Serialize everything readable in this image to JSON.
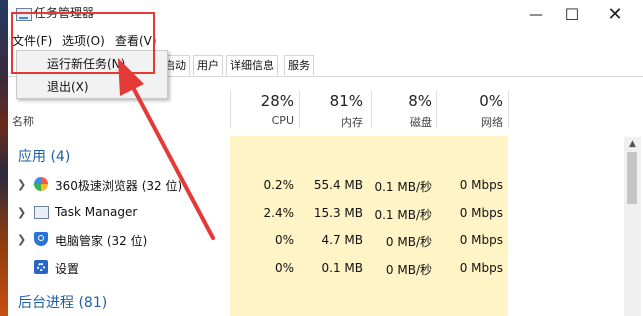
{
  "titlebar": {
    "title": "任务管理器",
    "min": "—",
    "max": "☐",
    "close": "✕"
  },
  "menubar": {
    "file": "文件(F)",
    "options": "选项(O)",
    "view": "查看(V)"
  },
  "file_menu": {
    "run_new_task": "运行新任务(N)",
    "exit": "退出(X)"
  },
  "tabs": [
    "启动",
    "用户",
    "详细信息",
    "服务"
  ],
  "columns": {
    "name": "名称",
    "cpu": {
      "pct": "28%",
      "label": "CPU"
    },
    "memory": {
      "pct": "81%",
      "label": "内存"
    },
    "disk": {
      "pct": "8%",
      "label": "磁盘"
    },
    "network": {
      "pct": "0%",
      "label": "网络"
    }
  },
  "groups": {
    "apps": "应用 (4)",
    "background": "后台进程 (81)"
  },
  "rows": [
    {
      "name": "360极速浏览器 (32 位)",
      "icon": "browser-360-icon",
      "cpu": "0.2%",
      "memory": "55.4 MB",
      "disk": "0.1 MB/秒",
      "network": "0 Mbps"
    },
    {
      "name": "Task Manager",
      "icon": "task-manager-icon",
      "cpu": "2.4%",
      "memory": "15.3 MB",
      "disk": "0.1 MB/秒",
      "network": "0 Mbps"
    },
    {
      "name": "电脑管家 (32 位)",
      "icon": "pc-manager-shield-icon",
      "cpu": "0%",
      "memory": "4.7 MB",
      "disk": "0 MB/秒",
      "network": "0 Mbps"
    },
    {
      "name": "设置",
      "icon": "settings-gear-icon",
      "cpu": "0%",
      "memory": "0.1 MB",
      "disk": "0 MB/秒",
      "network": "0 Mbps"
    }
  ],
  "annotation": {
    "color": "#e53935"
  },
  "colors": {
    "usage_shade": "#fff4c6",
    "group_text": "#1f5fa8"
  },
  "icons": {
    "expand": "chevron-right-icon",
    "scroll_up": "chevron-up-icon"
  }
}
